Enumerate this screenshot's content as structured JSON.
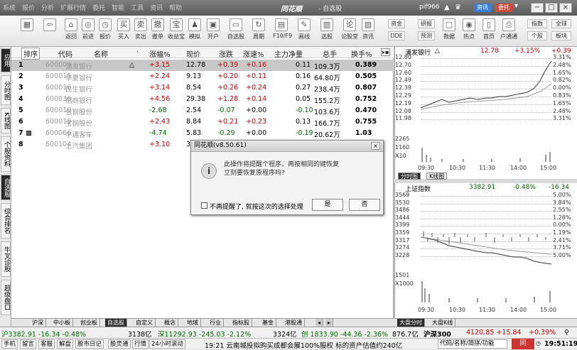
{
  "titlebar": {
    "menus": [
      "系统",
      "报价",
      "分析",
      "扩展行情",
      "委托",
      "智能",
      "工具",
      "资讯",
      "帮助"
    ],
    "app_name": "同花顺",
    "window_sub": "- 自选股",
    "user": "pif966",
    "pill1": "资讯",
    "pill2": "委托"
  },
  "toolbar": {
    "buttons": [
      "返回",
      "前进",
      "报价",
      "周期",
      "买入",
      "卖出",
      "撤单",
      "收益宝",
      "模拟",
      "开户",
      "自选股",
      "周期",
      "F10/F9",
      "画线",
      "选股",
      "论股堂",
      "资讯"
    ],
    "right": [
      "资金",
      "研报",
      "DDE",
      "预测",
      "数据",
      "热点",
      "首页",
      "户通通",
      "指数",
      "个股",
      "全球",
      "板块"
    ]
  },
  "lefttabs": [
    "应用",
    "分时图",
    "K线图",
    "个股资料",
    "自选股",
    "综合排名",
    "牛叉诊股",
    "超级盘口"
  ],
  "table": {
    "headers": [
      "排序",
      "代码",
      "名称",
      "·",
      "涨幅%",
      "现价",
      "涨跌",
      "涨速%",
      "主力净量",
      "总手",
      "换手%"
    ],
    "rows": [
      {
        "n": "1",
        "code": "600000",
        "name": "浦发银行",
        "flag": "△",
        "pct": "+3.15",
        "price": "12.78",
        "chg": "+0.39",
        "speed": "+0.16",
        "net": "0.11",
        "vol": "109.3万",
        "turn": "0.389"
      },
      {
        "n": "2",
        "code": "600015",
        "name": "华夏银行",
        "flag": "",
        "pct": "+2.24",
        "price": "9.13",
        "chg": "+0.20",
        "speed": "+0.11",
        "net": "0.16",
        "vol": "64.80万",
        "turn": "0.505"
      },
      {
        "n": "3",
        "code": "600016",
        "name": "民生银行",
        "flag": "",
        "pct": "+3.14",
        "price": "8.54",
        "chg": "+0.26",
        "speed": "+0.24",
        "net": "0.27",
        "vol": "238.4万",
        "turn": "0.807"
      },
      {
        "n": "4",
        "code": "600036",
        "name": "招商银行",
        "flag": "",
        "pct": "+4.56",
        "price": "29.38",
        "chg": "+1.28",
        "speed": "+0.14",
        "net": "0.05",
        "vol": "155.2万",
        "turn": "0.752"
      },
      {
        "n": "5",
        "code": "600010",
        "name": "包钢股份",
        "flag": "",
        "pct": "-2.68",
        "price": "2.54",
        "chg": "-0.07",
        "speed": "+0.00",
        "net": "-0.10",
        "vol": "103.6万",
        "turn": "0.470"
      },
      {
        "n": "6",
        "code": "600019",
        "name": "宝钢股份",
        "flag": "",
        "pct": "+2.43",
        "price": "8.84",
        "chg": "+0.21",
        "speed": "+0.23",
        "net": "0.13",
        "vol": "166.7万",
        "turn": "0.755"
      },
      {
        "n": "7",
        "code": "600066",
        "name": "宇通客车",
        "flag": "",
        "pct": "-4.74",
        "price": "5.83",
        "chg": "-0.29",
        "speed": "+0.00",
        "net": "-0.19",
        "vol": "20.62万",
        "turn": "1.03"
      },
      {
        "n": "8",
        "code": "600104",
        "name": "上汽集团",
        "flag": "",
        "pct": "+3.10",
        "price": "31",
        "chg": "",
        "speed": "",
        "net": "",
        "vol": "",
        "turn": ""
      }
    ]
  },
  "dialog": {
    "title": "同花顺(v8.50.61)",
    "msg1": "此操作将提醒个程序，再按相同的键恢复",
    "msg2": "立刻要恢复原程序吗?",
    "checkbox": "不再提醒了, 就按这次的选择处理",
    "yes": "是",
    "no": "否"
  },
  "panel1": {
    "name": "浦发银行",
    "price": "12.78",
    "pct": "+3.15%",
    "diff": "+0.39",
    "left_axis": [
      "12.80",
      "12.70",
      "12.60",
      "12.49",
      "12.39",
      "12.29",
      "12.19",
      "12.08",
      "11.98",
      "2265",
      "1160",
      "X10"
    ],
    "right_axis": [
      "3.31%",
      "2.48%",
      "1.65%",
      "0.82%",
      "0.00%",
      "0.83%",
      "1.65%",
      "2.48%",
      "3.31%"
    ],
    "times": [
      "09:30",
      "10:30",
      "11:30",
      "14:00",
      "15:00"
    ],
    "tabs": [
      "分时图",
      "K线图"
    ]
  },
  "panel2": {
    "name": "上证指数",
    "price": "3382.91",
    "pct": "-0.48%",
    "diff": "-16.34",
    "left_axis": [
      "3569",
      "3530",
      "3486",
      "3444",
      "3399",
      "3359",
      "3317",
      "3274",
      "3228",
      "1501",
      "X1000"
    ],
    "right_axis": [
      "5.00%",
      "3.84%",
      "2.55%",
      "1.28%",
      "0.00%",
      "1.19%",
      "2.41%",
      "3.71%",
      "5.00%"
    ],
    "times": [
      "09:30",
      "10:30",
      "11:30",
      "14:00",
      "15:00"
    ]
  },
  "bottom_tabs": [
    "沪深",
    "中小板",
    "创业板",
    "自选股",
    "自定义",
    "概念",
    "地域",
    "行业",
    "指标股",
    "基金",
    "港股通"
  ],
  "right_bottom_tabs": [
    "大盘分时",
    "大盘K线"
  ],
  "status1": {
    "sh": "沪3382.91  -16.34  -0.48%",
    "sh_amt": "3138亿",
    "sz": "深11292.93  -245.03  -2.12%",
    "sz_amt": "3324亿",
    "cyb": "创  1833.90  -44.36  -2.36%",
    "cyb_amt": "876.7亿",
    "hs300": "沪深300",
    "hs300_val": "4120.85  +15.84",
    "hs300_pct": "+0.39%"
  },
  "status2": {
    "buttons": [
      "手机",
      "留言",
      "客服",
      "解盘",
      "股市日记",
      "股灵通",
      "行情",
      "24小时滚动"
    ],
    "news": "19:21 云南城投拟购买成都会展100%股权 标的资产估值约240亿",
    "search": "代码/名称/简拼/功能",
    "clock": "19:51:19"
  }
}
